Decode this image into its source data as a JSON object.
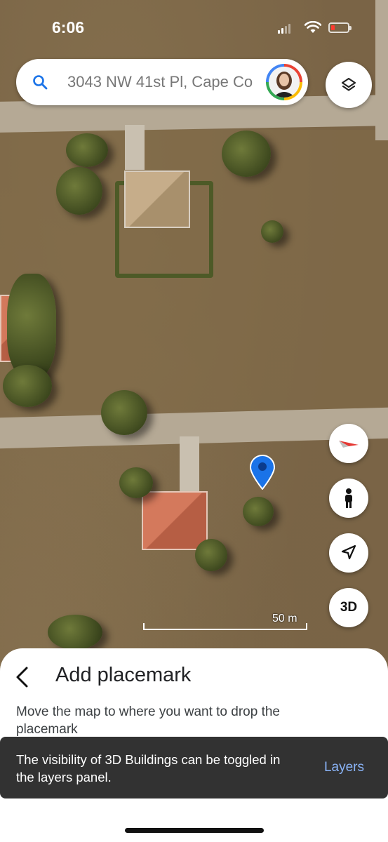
{
  "status_bar": {
    "time": "6:06"
  },
  "search": {
    "query": "3043 NW 41st Pl, Cape Co"
  },
  "map": {
    "scale_label": "50 m"
  },
  "buttons": {
    "three_d_label": "3D"
  },
  "sheet": {
    "title": "Add placemark",
    "description": "Move the map to where you want to drop the placemark"
  },
  "snackbar": {
    "message": "The visibility of 3D Buildings can be toggled in the layers panel.",
    "action": "Layers"
  },
  "colors": {
    "pin": "#1a73e8",
    "snackbar_action": "#8ab4f8"
  }
}
